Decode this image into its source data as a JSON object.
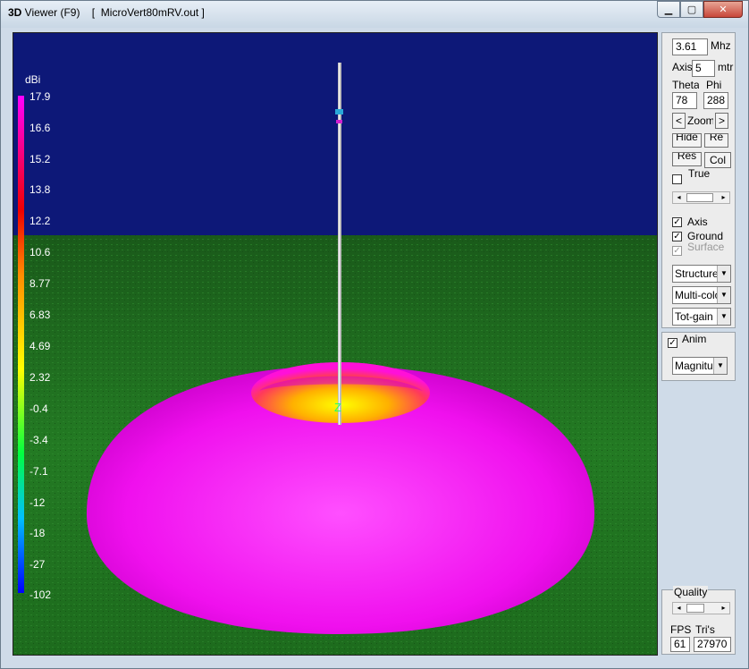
{
  "window": {
    "title_prefix": "3D",
    "title_rest": " Viewer (F9)    [  MicroVert80mRV.out ]",
    "minimize_icon": "minimize-icon",
    "maximize_icon": "maximize-icon",
    "close_icon": "close-icon"
  },
  "legend": {
    "unit": "dBi",
    "ticks": [
      "17.9",
      "16.6",
      "15.2",
      "13.8",
      "12.2",
      "10.6",
      "8.77",
      "6.83",
      "4.69",
      "2.32",
      "-0.4",
      "-3.4",
      "-7.1",
      "-12",
      "-18",
      "-27",
      "-102"
    ]
  },
  "antenna_marker": "Z",
  "colors": {
    "sky": "#0d1878",
    "ground": "#1f6a1f",
    "pattern_max": "#ff00ff",
    "pattern_inner": "#ffff00"
  },
  "panel": {
    "frequency": "3.61",
    "frequency_unit": "Mhz",
    "axis_label": "Axis",
    "axis_value": "5",
    "axis_unit": "mtr",
    "theta_label": "Theta",
    "phi_label": "Phi",
    "theta_value": "78",
    "phi_value": "288",
    "zoom_left": "<",
    "zoom_label": "Zoom",
    "zoom_right": ">",
    "btn_a": "Hide",
    "btn_b": "Re",
    "btn_c": "Res",
    "btn_col": "Col",
    "check_true_label": "True",
    "check_axis_label": "Axis",
    "check_axis": "✓",
    "check_ground_label": "Ground",
    "check_ground": "✓",
    "check_surface_label": "Surface",
    "check_surface": "✓",
    "select_structure": "Structure",
    "select_color": "Multi-color",
    "select_gain": "Tot-gain",
    "check_anim_label": "Anim",
    "check_anim": "✓",
    "select_mode": "Magnitude",
    "quality_label": "Quality",
    "fps_label": "FPS",
    "tris_label": "Tri's",
    "fps_value": "61",
    "tris_value": "27970"
  }
}
